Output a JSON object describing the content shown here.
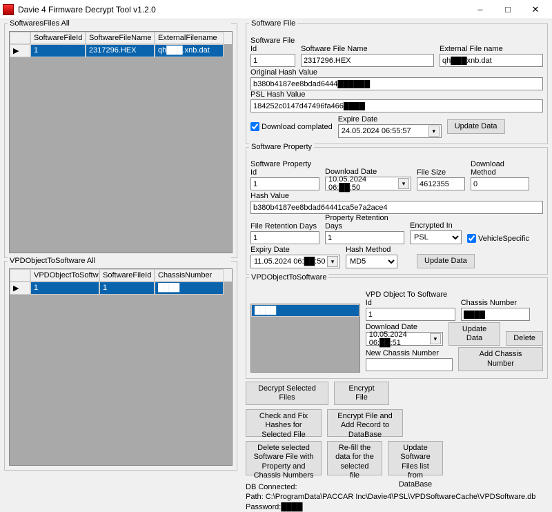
{
  "window": {
    "title": "Davie 4 Firmware Decrypt Tool v1.2.0",
    "minimize": "–",
    "maximize": "□",
    "close": "✕"
  },
  "left": {
    "grid1_title": "SoftwaresFiles All",
    "grid1_cols": {
      "c1": "SoftwareFileId",
      "c2": "SoftwareFileName",
      "c3": "ExternalFilename"
    },
    "grid1_row": {
      "c1": "1",
      "c2": "2317296.HEX",
      "c3": "qh███.xnb.dat"
    },
    "grid2_title": "VPDObjectToSoftware All",
    "grid2_cols": {
      "c1": "VPDObjectToSoftw",
      "c2": "SoftwareFileId",
      "c3": "ChassisNumber"
    },
    "grid2_row": {
      "c1": "1",
      "c2": "1",
      "c3": "████"
    }
  },
  "sf": {
    "title": "Software File",
    "file_id_lbl": "Software File Id",
    "file_id": "1",
    "file_name_lbl": "Software File Name",
    "file_name": "2317296.HEX",
    "ext_name_lbl": "External File name",
    "ext_name": "qh███xnb.dat",
    "orig_hash_lbl": "Original Hash Value",
    "orig_hash": "b380b4187ee8bdad6444██████",
    "psl_hash_lbl": "PSL Hash Value",
    "psl_hash": "184252c0147d47496fa466████",
    "dl_complete": "Download complated",
    "expire_lbl": "Expire Date",
    "expire": "24.05.2024 06:55:57",
    "update_btn": "Update Data"
  },
  "sp": {
    "title": "Software Property",
    "prop_id_lbl": "Software Property Id",
    "prop_id": "1",
    "dl_date_lbl": "Download Date",
    "dl_date": "10.05.2024 06:██:50",
    "file_size_lbl": "File Size",
    "file_size": "4612355",
    "dl_method_lbl": "Download Method",
    "dl_method": "0",
    "hash_lbl": "Hash Value",
    "hash": "b380b4187ee8bdad64441ca5e7a2ace4",
    "ret_days_lbl": "File Retention Days",
    "ret_days": "1",
    "prop_ret_lbl": "Property Retention Days",
    "prop_ret": "1",
    "enc_in_lbl": "Encrypted In",
    "enc_in": "PSL",
    "vehicle_chk": "VehicleSpecific",
    "expiry_lbl": "Expiry Date",
    "expiry": "11.05.2024 06:██:50",
    "hash_method_lbl": "Hash Method",
    "hash_method": "MD5",
    "update_btn": "Update Data"
  },
  "vpd": {
    "title": "VPDObjectToSoftware",
    "obj_id_lbl": "VPD Object To Software Id",
    "obj_id": "1",
    "chassis_lbl": "Chassis Number",
    "chassis": "████",
    "dl_date_lbl": "Download Date",
    "dl_date": "10.05.2024 06:██:51",
    "update_btn": "Update Data",
    "delete_btn": "Delete",
    "new_chassis_lbl": "New Chassis Number",
    "add_chassis_btn": "Add Chassis Number"
  },
  "actions": {
    "decrypt": "Decrypt Selected Files",
    "encrypt": "Encrypt File",
    "checkfix": "Check and Fix Hashes for Selected File",
    "encadd": "Encrypt File and Add Record to DataBase",
    "delsel": "Delete selected Software File with Property and Chassis Numbers",
    "refill": "Re-fill the data for the selected file",
    "updatelist": "Update Software Files list from DataBase"
  },
  "db": {
    "connected": "DB Connected:",
    "path": "Path: C:\\ProgramData\\PACCAR Inc\\Davie4\\PSL\\VPDSoftwareCache\\VPDSoftware.db",
    "password": "Password:████"
  }
}
